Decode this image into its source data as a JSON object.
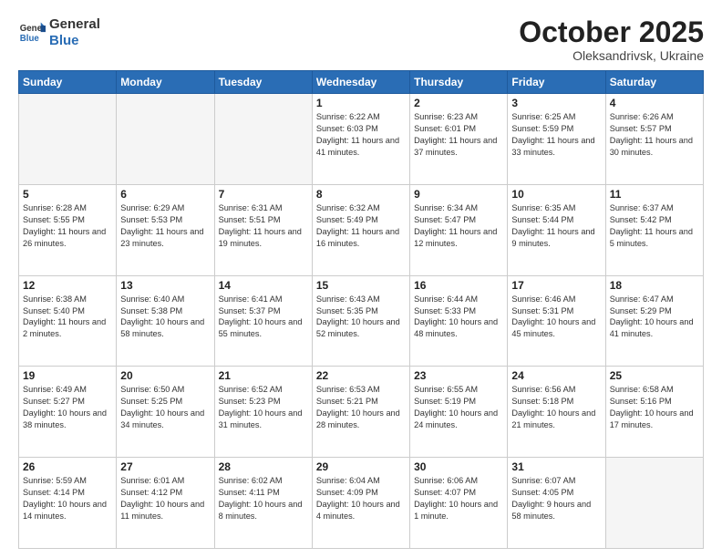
{
  "header": {
    "logo_line1": "General",
    "logo_line2": "Blue",
    "month": "October 2025",
    "location": "Oleksandrivsk, Ukraine"
  },
  "days_of_week": [
    "Sunday",
    "Monday",
    "Tuesday",
    "Wednesday",
    "Thursday",
    "Friday",
    "Saturday"
  ],
  "weeks": [
    [
      {
        "day": "",
        "info": ""
      },
      {
        "day": "",
        "info": ""
      },
      {
        "day": "",
        "info": ""
      },
      {
        "day": "1",
        "info": "Sunrise: 6:22 AM\nSunset: 6:03 PM\nDaylight: 11 hours\nand 41 minutes."
      },
      {
        "day": "2",
        "info": "Sunrise: 6:23 AM\nSunset: 6:01 PM\nDaylight: 11 hours\nand 37 minutes."
      },
      {
        "day": "3",
        "info": "Sunrise: 6:25 AM\nSunset: 5:59 PM\nDaylight: 11 hours\nand 33 minutes."
      },
      {
        "day": "4",
        "info": "Sunrise: 6:26 AM\nSunset: 5:57 PM\nDaylight: 11 hours\nand 30 minutes."
      }
    ],
    [
      {
        "day": "5",
        "info": "Sunrise: 6:28 AM\nSunset: 5:55 PM\nDaylight: 11 hours\nand 26 minutes."
      },
      {
        "day": "6",
        "info": "Sunrise: 6:29 AM\nSunset: 5:53 PM\nDaylight: 11 hours\nand 23 minutes."
      },
      {
        "day": "7",
        "info": "Sunrise: 6:31 AM\nSunset: 5:51 PM\nDaylight: 11 hours\nand 19 minutes."
      },
      {
        "day": "8",
        "info": "Sunrise: 6:32 AM\nSunset: 5:49 PM\nDaylight: 11 hours\nand 16 minutes."
      },
      {
        "day": "9",
        "info": "Sunrise: 6:34 AM\nSunset: 5:47 PM\nDaylight: 11 hours\nand 12 minutes."
      },
      {
        "day": "10",
        "info": "Sunrise: 6:35 AM\nSunset: 5:44 PM\nDaylight: 11 hours\nand 9 minutes."
      },
      {
        "day": "11",
        "info": "Sunrise: 6:37 AM\nSunset: 5:42 PM\nDaylight: 11 hours\nand 5 minutes."
      }
    ],
    [
      {
        "day": "12",
        "info": "Sunrise: 6:38 AM\nSunset: 5:40 PM\nDaylight: 11 hours\nand 2 minutes."
      },
      {
        "day": "13",
        "info": "Sunrise: 6:40 AM\nSunset: 5:38 PM\nDaylight: 10 hours\nand 58 minutes."
      },
      {
        "day": "14",
        "info": "Sunrise: 6:41 AM\nSunset: 5:37 PM\nDaylight: 10 hours\nand 55 minutes."
      },
      {
        "day": "15",
        "info": "Sunrise: 6:43 AM\nSunset: 5:35 PM\nDaylight: 10 hours\nand 52 minutes."
      },
      {
        "day": "16",
        "info": "Sunrise: 6:44 AM\nSunset: 5:33 PM\nDaylight: 10 hours\nand 48 minutes."
      },
      {
        "day": "17",
        "info": "Sunrise: 6:46 AM\nSunset: 5:31 PM\nDaylight: 10 hours\nand 45 minutes."
      },
      {
        "day": "18",
        "info": "Sunrise: 6:47 AM\nSunset: 5:29 PM\nDaylight: 10 hours\nand 41 minutes."
      }
    ],
    [
      {
        "day": "19",
        "info": "Sunrise: 6:49 AM\nSunset: 5:27 PM\nDaylight: 10 hours\nand 38 minutes."
      },
      {
        "day": "20",
        "info": "Sunrise: 6:50 AM\nSunset: 5:25 PM\nDaylight: 10 hours\nand 34 minutes."
      },
      {
        "day": "21",
        "info": "Sunrise: 6:52 AM\nSunset: 5:23 PM\nDaylight: 10 hours\nand 31 minutes."
      },
      {
        "day": "22",
        "info": "Sunrise: 6:53 AM\nSunset: 5:21 PM\nDaylight: 10 hours\nand 28 minutes."
      },
      {
        "day": "23",
        "info": "Sunrise: 6:55 AM\nSunset: 5:19 PM\nDaylight: 10 hours\nand 24 minutes."
      },
      {
        "day": "24",
        "info": "Sunrise: 6:56 AM\nSunset: 5:18 PM\nDaylight: 10 hours\nand 21 minutes."
      },
      {
        "day": "25",
        "info": "Sunrise: 6:58 AM\nSunset: 5:16 PM\nDaylight: 10 hours\nand 17 minutes."
      }
    ],
    [
      {
        "day": "26",
        "info": "Sunrise: 5:59 AM\nSunset: 4:14 PM\nDaylight: 10 hours\nand 14 minutes."
      },
      {
        "day": "27",
        "info": "Sunrise: 6:01 AM\nSunset: 4:12 PM\nDaylight: 10 hours\nand 11 minutes."
      },
      {
        "day": "28",
        "info": "Sunrise: 6:02 AM\nSunset: 4:11 PM\nDaylight: 10 hours\nand 8 minutes."
      },
      {
        "day": "29",
        "info": "Sunrise: 6:04 AM\nSunset: 4:09 PM\nDaylight: 10 hours\nand 4 minutes."
      },
      {
        "day": "30",
        "info": "Sunrise: 6:06 AM\nSunset: 4:07 PM\nDaylight: 10 hours\nand 1 minute."
      },
      {
        "day": "31",
        "info": "Sunrise: 6:07 AM\nSunset: 4:05 PM\nDaylight: 9 hours\nand 58 minutes."
      },
      {
        "day": "",
        "info": ""
      }
    ]
  ]
}
